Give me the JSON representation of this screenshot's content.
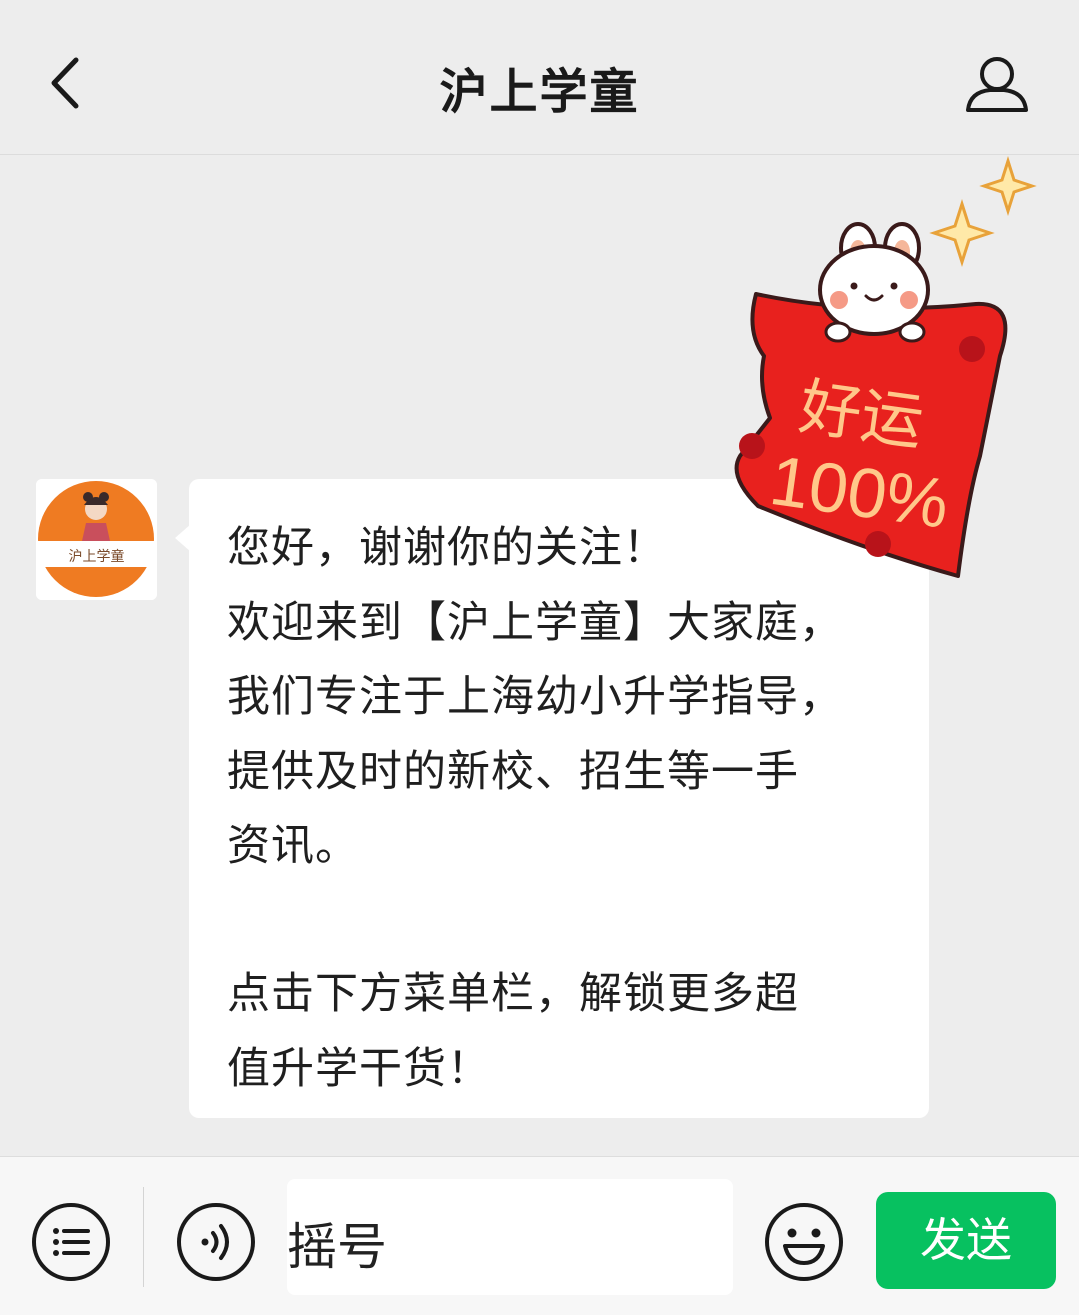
{
  "header": {
    "title": "沪上学童",
    "back_icon": "chevron-left-icon",
    "profile_icon": "user-icon"
  },
  "chat": {
    "avatar": {
      "logo_text": "沪上学童",
      "color": "#ef7b22"
    },
    "message": {
      "lines": [
        "您好，谢谢你的关注！",
        "欢迎来到【沪上学童】大家庭，",
        "我们专注于上海幼小升学指导，",
        "提供及时的新校、招生等一手",
        "资讯。",
        "",
        "点击下方菜单栏，解锁更多超",
        "值升学干货！"
      ]
    },
    "sticker": {
      "line1": "好运",
      "line2": "100%",
      "color": "#e8211e"
    }
  },
  "bottom_bar": {
    "menu_icon": "list-icon",
    "voice_icon": "voice-icon",
    "input_value": "摇号",
    "emoji_icon": "emoji-icon",
    "send_label": "发送",
    "send_color": "#07c160"
  }
}
